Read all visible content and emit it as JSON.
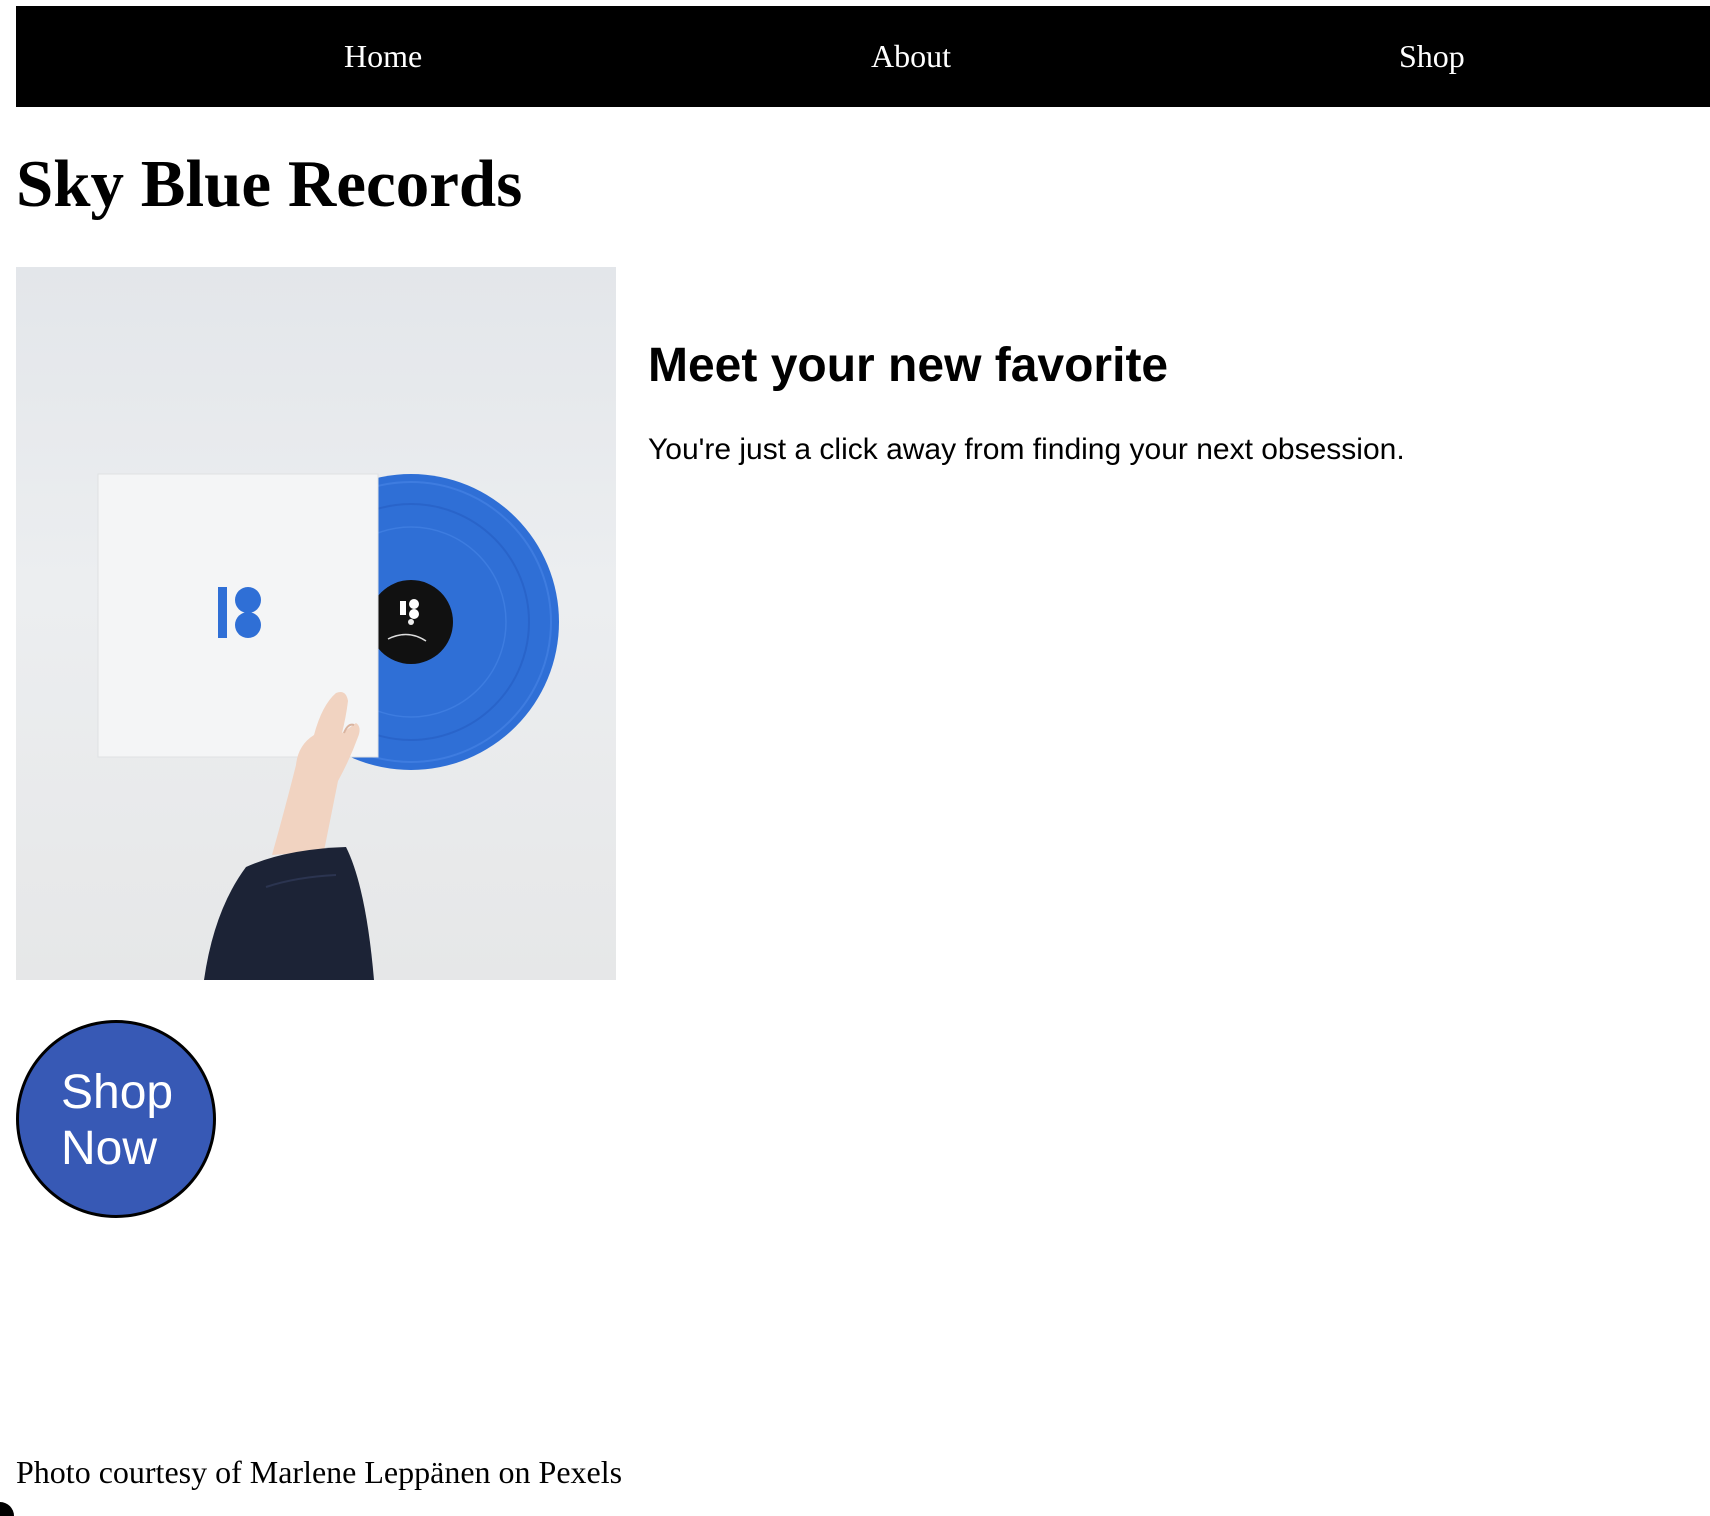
{
  "nav": {
    "items": [
      {
        "label": "Home"
      },
      {
        "label": "About"
      },
      {
        "label": "Shop"
      }
    ]
  },
  "header": {
    "title": "Sky Blue Records"
  },
  "hero": {
    "image_icon": "vinyl-record-photo"
  },
  "promo": {
    "heading": "Meet your new favorite",
    "text": "You're just a click away from finding your next obsession."
  },
  "cta": {
    "line1": "Shop",
    "line2": "Now",
    "color": "#3759b5"
  },
  "footer": {
    "credit": "Photo courtesy of Marlene Leppänen on Pexels"
  }
}
